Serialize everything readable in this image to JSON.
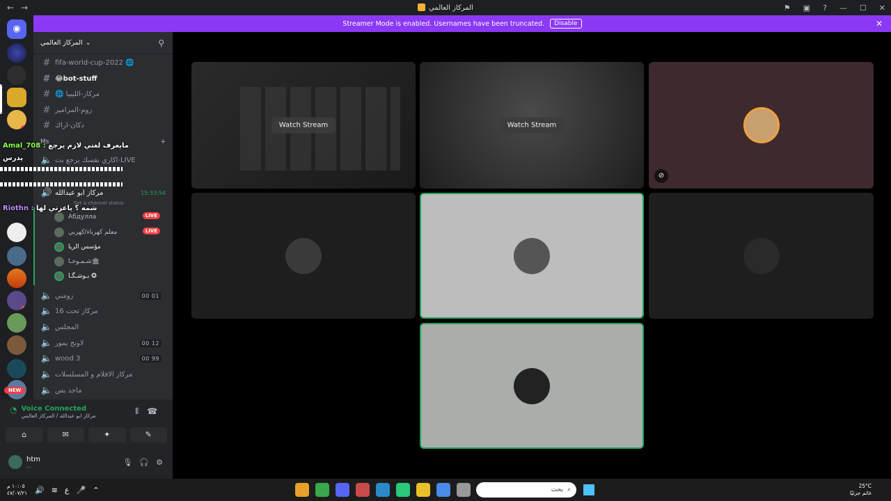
{
  "titlebar": {
    "title": "المركاز العالمي",
    "back": "←",
    "forward": "→",
    "inbox": "⚑",
    "window": "▣",
    "help": "?",
    "min": "—",
    "max": "☐",
    "close": "✕"
  },
  "banner": {
    "text": "Streamer Mode is enabled. Usernames have been truncated.",
    "disable": "Disable",
    "close": "✕"
  },
  "server": {
    "name": "المركاز العالمي",
    "add_user": "⚲"
  },
  "channels": {
    "text": [
      {
        "name": "fifa-world-cup-2022 🌐"
      },
      {
        "name": "😂bot-stuff"
      },
      {
        "name": "🌐 مركاز-الليبيا"
      },
      {
        "name": "زوم-المزامير"
      },
      {
        "name": "دكان-اراك"
      }
    ],
    "category": "Ms",
    "voice": [
      {
        "name": "اكاري نفسك يرجع بت-LIVE"
      },
      {
        "name": "مركاز ابو عبدالله",
        "timer": "15:33:54",
        "status": "Set a channel status"
      },
      {
        "name": "زومني",
        "count": "00 01"
      },
      {
        "name": "مركاز تحت 16"
      },
      {
        "name": "المجلس"
      },
      {
        "name": "لاونج يمور",
        "count": "00 12"
      },
      {
        "name": "wood 3",
        "count": "00 99"
      },
      {
        "name": "مركاز الافلام و المسلسلات"
      },
      {
        "name": "ماجد بس"
      }
    ],
    "voice_users": [
      {
        "name": "Абдулла",
        "live": "LIVE"
      },
      {
        "name": "معلم كهرباء/كهربي",
        "live": "LIVE"
      },
      {
        "name": "مؤسس الريا"
      },
      {
        "name": "شـمـوخـا🏛"
      },
      {
        "name": "بـوشـگـا ✪"
      }
    ]
  },
  "chat_overlay": {
    "line1_user": "Amal_708 :",
    "line1_msg": "مايعرف لغتي لازم يرجع",
    "line1_cont": "يدرس",
    "line2_user": "Riothn :",
    "line2_msg": "شمه ؟ ياعزتي لها"
  },
  "guilds": {
    "badges": [
      "1",
      "3"
    ],
    "new": "NEW"
  },
  "voice_panel": {
    "status": "Voice Connected",
    "channel": "مركاز ابو عبدالله / المركاز العالمي",
    "user": "htm",
    "user_status": "...",
    "icons": [
      "⌂",
      "✉",
      "✦",
      "✎"
    ]
  },
  "stage": {
    "watch_label": "Watch Stream"
  },
  "taskbar": {
    "time": "١٠:٠٥ م",
    "date": "٤٧/٠٧/٢١",
    "lang": "ع",
    "search_placeholder": "بحث",
    "temp": "25°C",
    "weather": "غائم جزئيًا"
  }
}
